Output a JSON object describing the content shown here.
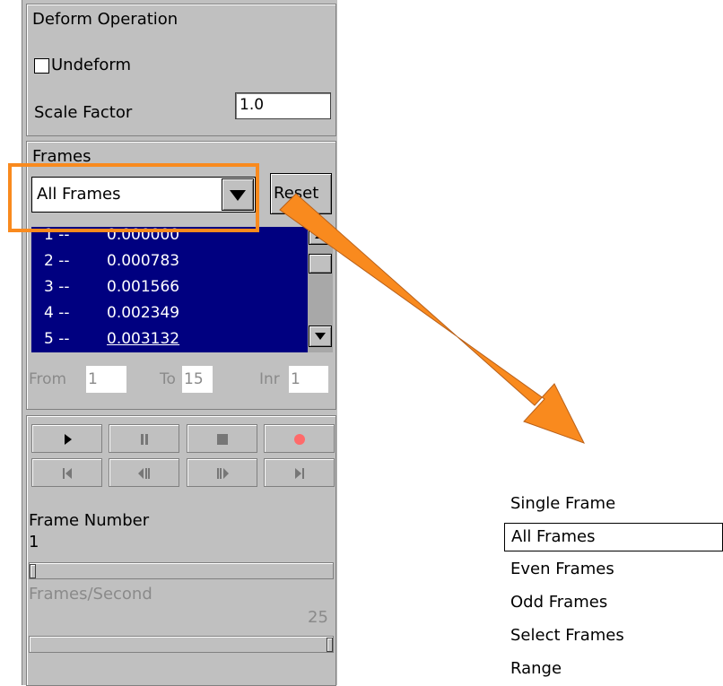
{
  "deform": {
    "section_title": "Deform Operation",
    "undeform_label": "Undeform",
    "undeform_checked": false,
    "scale_factor_label": "Scale Factor",
    "scale_factor_value": "1.0"
  },
  "frames": {
    "section_title": "Frames",
    "mode_selected": "All Frames",
    "reset_label": "Reset",
    "list": [
      {
        "index": "1 --",
        "time": "0.000000"
      },
      {
        "index": "2 --",
        "time": "0.000783"
      },
      {
        "index": "3 --",
        "time": "0.001566"
      },
      {
        "index": "4 --",
        "time": "0.002349"
      },
      {
        "index": "5 --",
        "time": "0.003132"
      }
    ],
    "from_label": "From",
    "from_value": "1",
    "to_label": "To",
    "to_value": "15",
    "inr_label": "Inr",
    "inr_value": "1"
  },
  "playback": {
    "buttons_row1": [
      "play-icon",
      "pause-icon",
      "stop-icon",
      "record-icon"
    ],
    "buttons_row2": [
      "first-frame-icon",
      "step-back-icon",
      "step-forward-icon",
      "last-frame-icon"
    ],
    "frame_number_label": "Frame Number",
    "frame_number_value": "1",
    "fps_label": "Frames/Second",
    "fps_value": "25",
    "frame_slider_fraction": 0.0,
    "fps_slider_fraction": 1.0
  },
  "dropdown_options": {
    "items": [
      "Single Frame",
      "All Frames",
      "Even Frames",
      "Odd Frames",
      "Select Frames",
      "Range"
    ],
    "selected": "All Frames"
  },
  "colors": {
    "highlight": "#f98a1e",
    "list_background": "#000080",
    "record": "#ff6a6a"
  }
}
